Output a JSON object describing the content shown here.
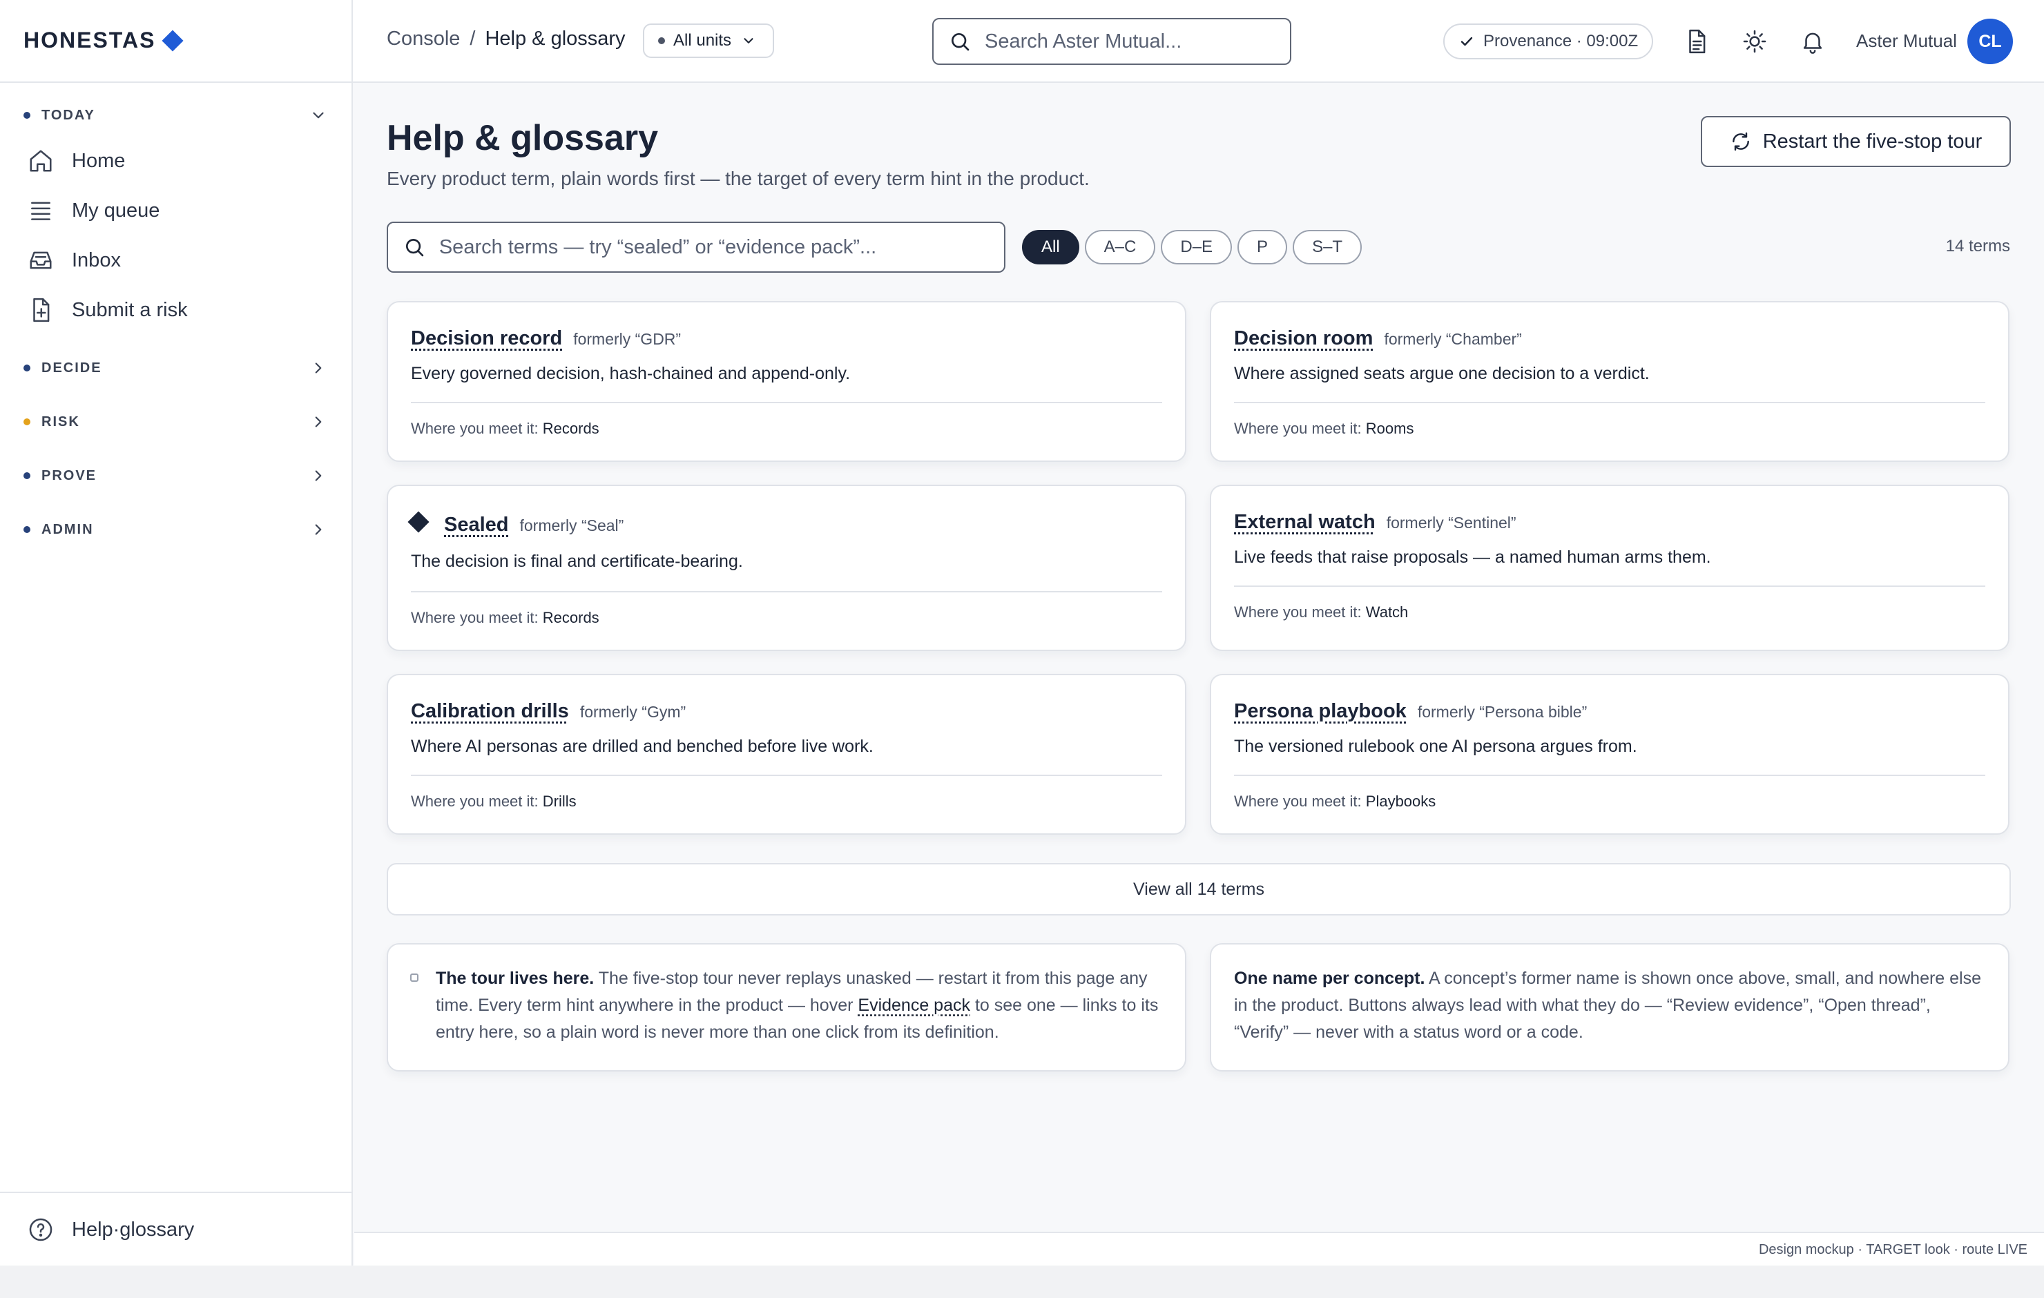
{
  "brand": {
    "name": "HONESTAS"
  },
  "sidebar": {
    "sections": [
      {
        "label": "TODAY"
      },
      {
        "label": "DECIDE"
      },
      {
        "label": "RISK"
      },
      {
        "label": "PROVE"
      },
      {
        "label": "ADMIN"
      }
    ],
    "today_items": [
      {
        "label": "Home",
        "icon": "home-icon"
      },
      {
        "label": "My queue",
        "icon": "list-icon"
      },
      {
        "label": "Inbox",
        "icon": "inbox-icon"
      },
      {
        "label": "Submit a risk",
        "icon": "file-plus-icon"
      }
    ],
    "footer": {
      "label": "Help·glossary",
      "icon": "help-circle-icon"
    }
  },
  "topbar": {
    "breadcrumb": {
      "root": "Console",
      "separator": "/",
      "current": "Help & glossary"
    },
    "units_select": "All units",
    "search_placeholder": "Search Aster Mutual...",
    "provenance": "Provenance · 09:00Z",
    "org": "Aster Mutual",
    "avatar_initials": "CL"
  },
  "page": {
    "title": "Help & glossary",
    "subtitle": "Every product term, plain words first — the target of every term hint in the product.",
    "restart_button": "Restart the five-stop tour",
    "search_placeholder": "Search terms — try “sealed” or “evidence pack”...",
    "filters": [
      "All",
      "A–C",
      "D–E",
      "P",
      "S–T"
    ],
    "active_filter": "All",
    "count": "14 terms"
  },
  "where_label": "Where you meet it:",
  "terms": [
    {
      "term": "Decision record",
      "formerly": "formerly “GDR”",
      "definition": "Every governed decision, hash-chained and append-only.",
      "where": "Records"
    },
    {
      "term": "Decision room",
      "formerly": "formerly “Chamber”",
      "definition": "Where assigned seats argue one decision to a verdict.",
      "where": "Rooms"
    },
    {
      "term": "Sealed",
      "formerly": "formerly “Seal”",
      "definition": "The decision is final and certificate-bearing.",
      "where": "Records"
    },
    {
      "term": "External watch",
      "formerly": "formerly “Sentinel”",
      "definition": "Live feeds that raise proposals — a named human arms them.",
      "where": "Watch"
    },
    {
      "term": "Calibration drills",
      "formerly": "formerly “Gym”",
      "definition": "Where AI personas are drilled and benched before live work.",
      "where": "Drills"
    },
    {
      "term": "Persona playbook",
      "formerly": "formerly “Persona bible”",
      "definition": "The versioned rulebook one AI persona argues from.",
      "where": "Playbooks"
    }
  ],
  "view_all": "View all 14 terms",
  "notes": {
    "tour": {
      "heading": "The tour lives here.",
      "text_a": " The five-stop tour never replays unasked — restart it from this page any time. Every term hint anywhere in the product — hover ",
      "hint": "Evidence pack",
      "text_b": " to see one — links to its entry here, so a plain word is never more than one click from its definition."
    },
    "naming": {
      "heading": "One name per concept.",
      "text": " A concept’s former name is shown once above, small, and nowhere else in the product. Buttons always lead with what they do — “Review evidence”, “Open thread”, “Verify” — never with a status word or a code."
    }
  },
  "footer_note": "Design mockup · TARGET look · route LIVE",
  "colors": {
    "accent": "#1f5bd6",
    "navy": "#1b2438",
    "risk_dot": "#e4a21c"
  }
}
